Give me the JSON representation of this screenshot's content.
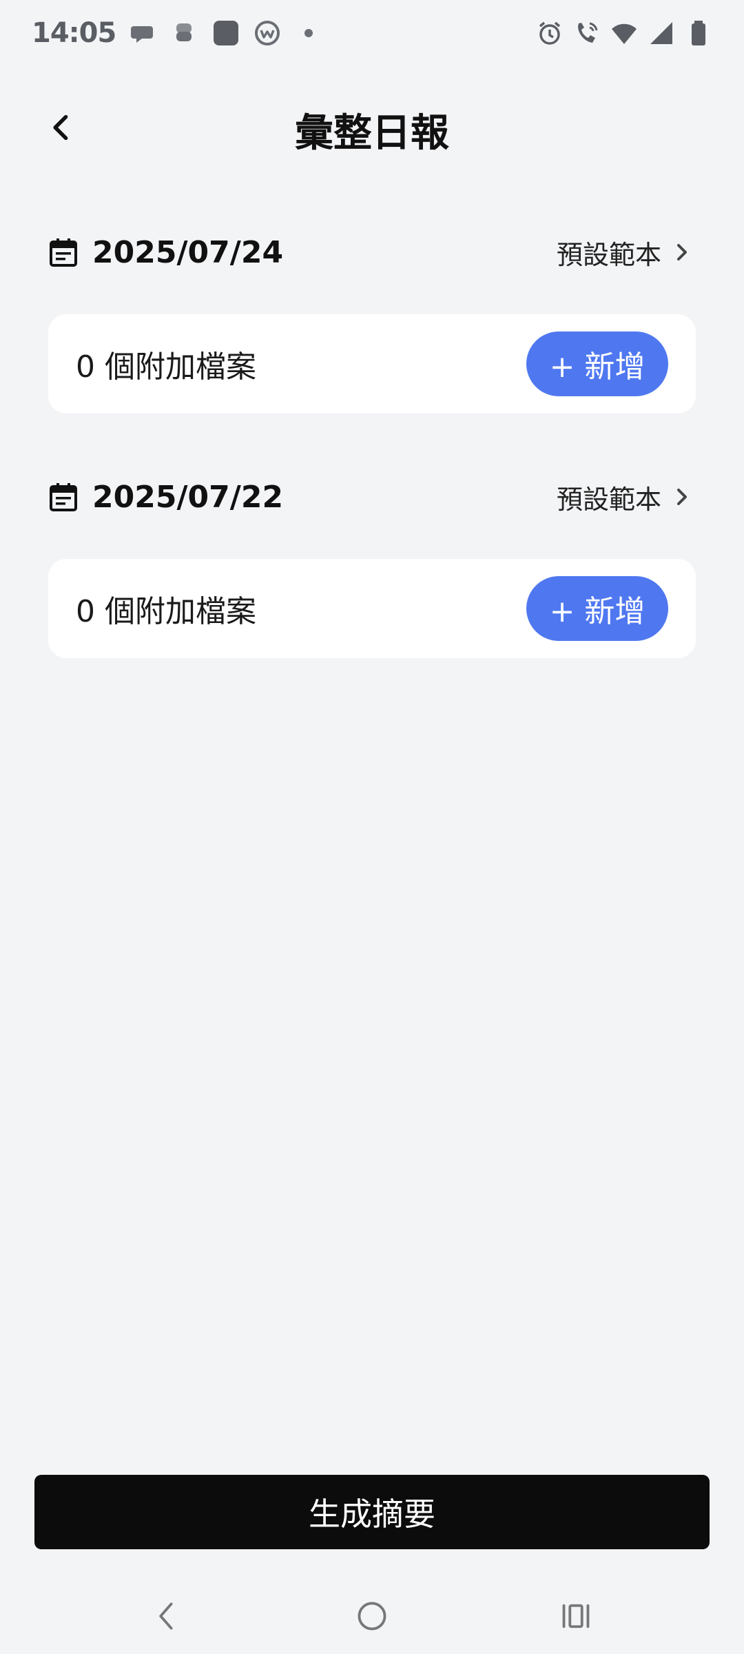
{
  "status_bar": {
    "time": "14:05",
    "left_icons": [
      "chat-bubble-icon",
      "layers-icon",
      "app-square-icon",
      "w-circle-icon",
      "dot-icon"
    ],
    "right_icons": [
      "alarm-icon",
      "wifi-call-icon",
      "wifi-icon",
      "signal-icon",
      "battery-icon"
    ]
  },
  "header": {
    "title": "彙整日報"
  },
  "sections": [
    {
      "date": "2025/07/24",
      "template_label": "預設範本",
      "attachments_text": "0 個附加檔案",
      "add_label": "+ 新增"
    },
    {
      "date": "2025/07/22",
      "template_label": "預設範本",
      "attachments_text": "0 個附加檔案",
      "add_label": "+ 新增"
    }
  ],
  "footer": {
    "generate_label": "生成摘要"
  },
  "colors": {
    "background": "#f3f4f6",
    "accent": "#4f78f0",
    "primary_button": "#0c0c0c"
  }
}
